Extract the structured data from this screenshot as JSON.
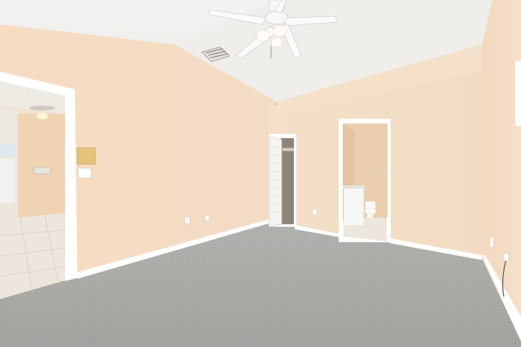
{
  "scene": {
    "kind": "photo",
    "subject": "empty-bedroom-interior",
    "colors": {
      "wall": "#f3dcc2",
      "wall_shadow": "#e9cfb4",
      "ceiling": "#f1f0ee",
      "carpet": "#a9aaa6",
      "trim": "#ffffff",
      "tile": "#ece5dc"
    }
  }
}
